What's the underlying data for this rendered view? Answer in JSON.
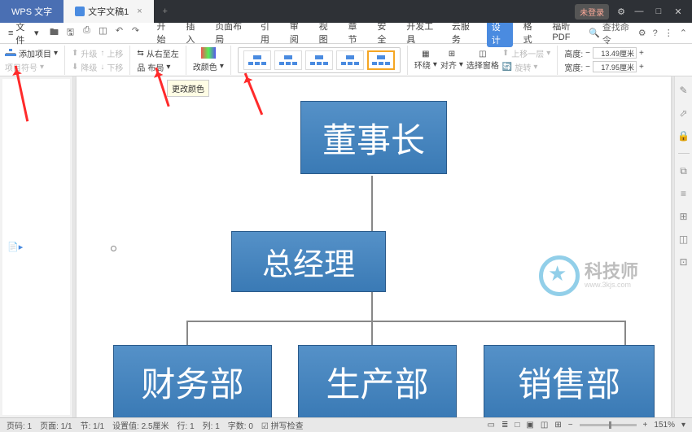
{
  "titlebar": {
    "appTab": "WPS 文字",
    "docTab": "文字文稿1",
    "close": "×",
    "add": "+",
    "login": "未登录",
    "gear": "⚙",
    "min": "—",
    "max": "□",
    "winclose": "✕"
  },
  "menubar": {
    "fileMenu": "文件",
    "hamburger": "≡",
    "dropdown": "▾",
    "qat": {
      "open": "🖿",
      "save": "🖫",
      "print": "⎙",
      "preview": "◫",
      "undo": "↶",
      "redo": "↷"
    },
    "tabs": {
      "start": "开始",
      "insert": "插入",
      "pageLayout": "页面布局",
      "reference": "引用",
      "review": "审阅",
      "view": "视图",
      "section": "章节",
      "security": "安全",
      "devtools": "开发工具",
      "cloud": "云服务",
      "design": "设计",
      "format": "格式",
      "foxitpdf": "福昕PDF"
    },
    "search": {
      "icon": "🔍",
      "label": "查找命令"
    },
    "wrench": "⚙",
    "question": "?",
    "more": "⋮",
    "chevron": "⌃"
  },
  "ribbon": {
    "addItem": "添加项目",
    "bulletSymbol": "项目符号",
    "promote": "升级",
    "demote": "降级",
    "moveUp": "上移",
    "moveDown": "下移",
    "rtl": "从右至左",
    "layout": "布局",
    "changeColor": "更改颜色",
    "changeColorCaret": "改颜色",
    "wrap": "环绕",
    "align": "对齐",
    "selPane": "选择窗格",
    "moveUp2": "上移一层",
    "moveDown2": "上移一层",
    "rotate": "旋转",
    "height": "高度:",
    "width": "宽度:",
    "heightVal": "13.49厘米",
    "widthVal": "17.95厘米"
  },
  "tooltip": "更改颜色",
  "chart": {
    "chairman": "董事长",
    "gm": "总经理",
    "finance": "财务部",
    "production": "生产部",
    "sales": "销售部"
  },
  "watermark": {
    "brand": "科技师",
    "sub": "www.3kjs.com"
  },
  "sidepanel": {
    "pen": "✎",
    "cursor": "⬀",
    "lock": "🔒",
    "tool1": "⧉",
    "tool2": "≡",
    "tool3": "⊞",
    "tool4": "◫",
    "tool5": "⊡"
  },
  "status": {
    "pageLabel": "页码: 1",
    "pages": "页面: 1/1",
    "section": "节: 1/1",
    "setVal": "设置值: 2.5厘米",
    "row": "行: 1",
    "col": "列: 1",
    "chars": "字数: 0",
    "spell": "☑ 拼写检查",
    "icons": {
      "i1": "▭",
      "i2": "≣",
      "i3": "□",
      "i4": "▣",
      "i5": "◫",
      "i6": "⊞"
    },
    "zminus": "−",
    "zplus": "+",
    "zoom": "151%",
    "zcaret": "▾"
  }
}
